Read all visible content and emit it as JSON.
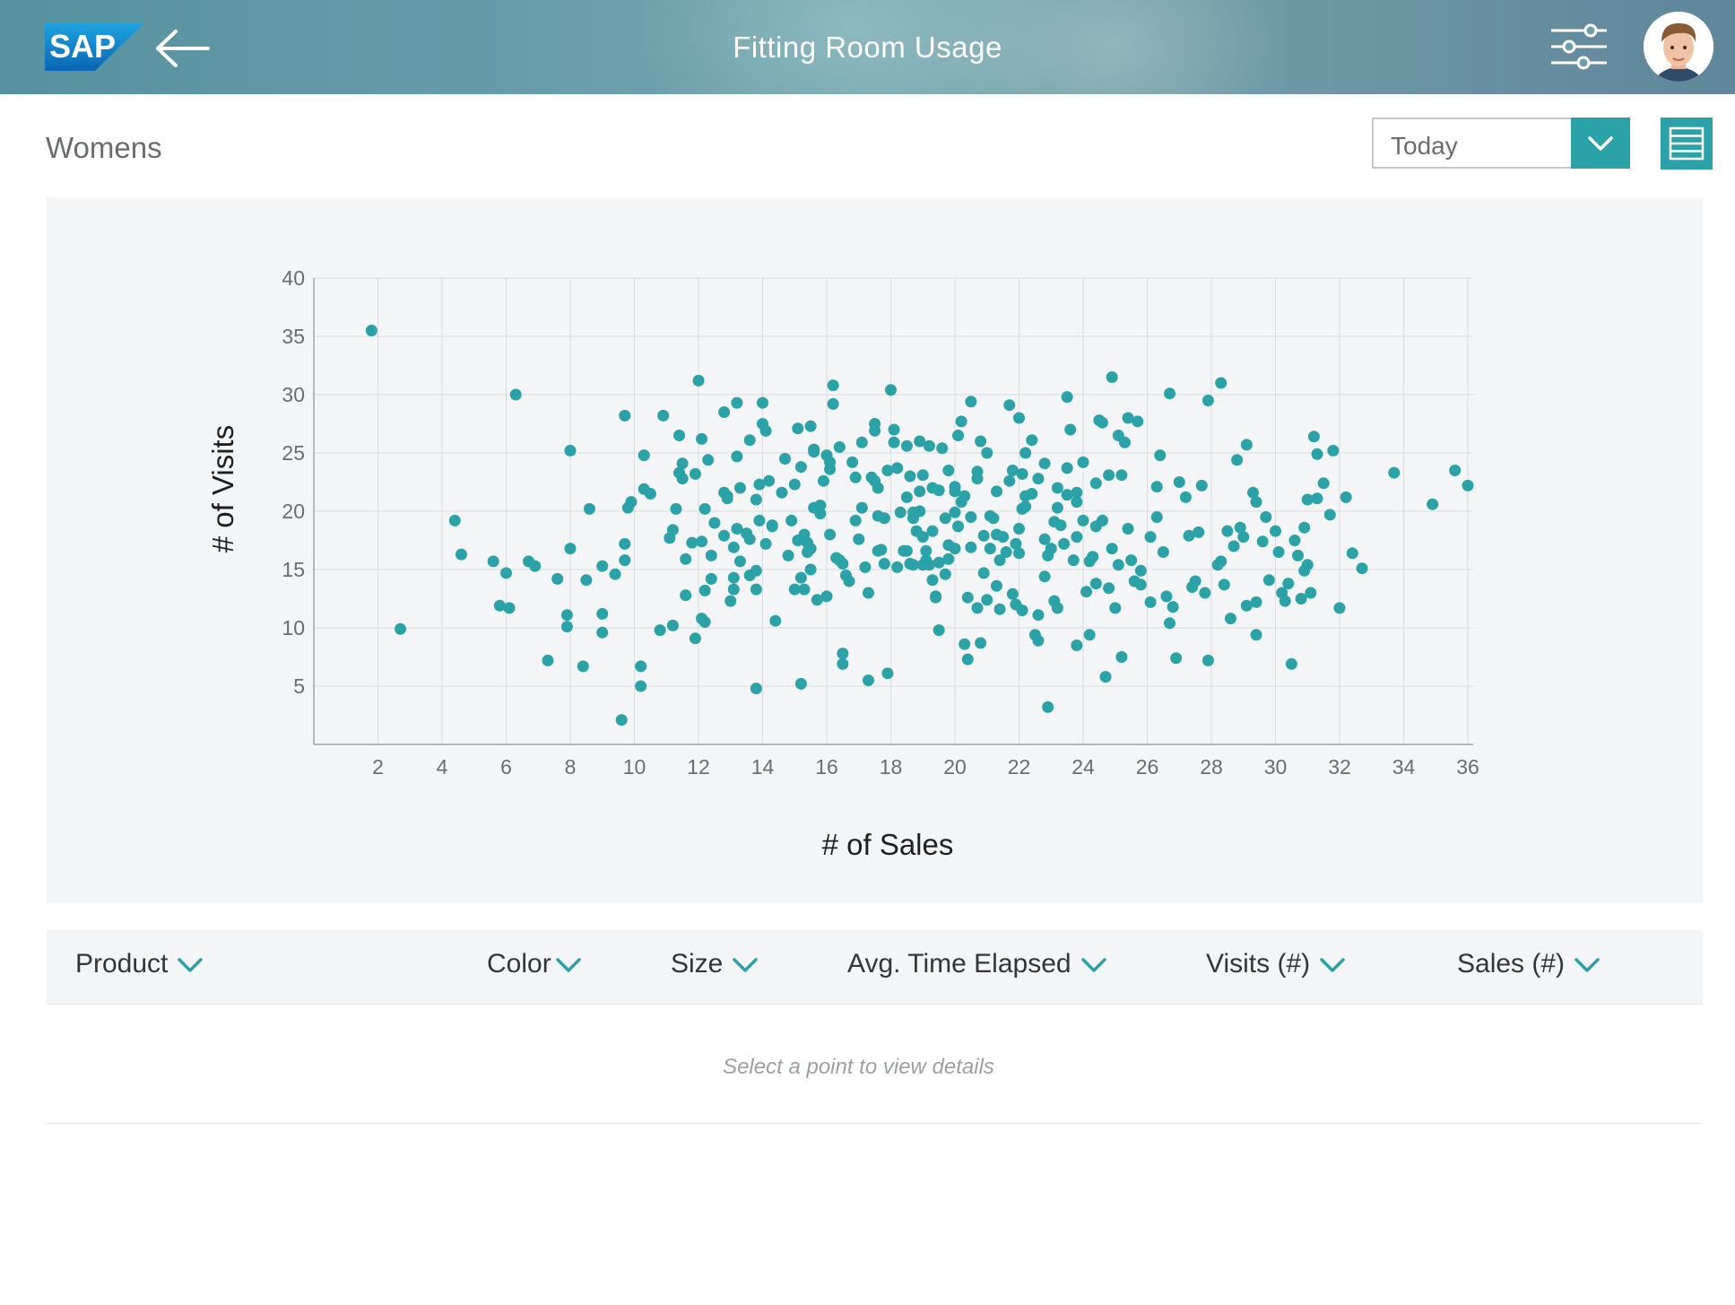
{
  "header": {
    "logo_text": "SAP",
    "title": "Fitting Room Usage",
    "back_icon": "arrow-left-icon",
    "settings_icon": "sliders-icon",
    "avatar_icon": "user-avatar"
  },
  "section": {
    "title": "Womens"
  },
  "filter": {
    "selected": "Today",
    "dropdown_icon": "chevron-down-icon",
    "view_icon": "list-view-icon"
  },
  "colors": {
    "accent": "#2aa2a7",
    "header_bg": "#6a9fab",
    "panel_bg": "#f4f5f6"
  },
  "table": {
    "columns": [
      "Product",
      "Color",
      "Size",
      "Avg. Time Elapsed",
      "Visits (#)",
      "Sales (#)"
    ],
    "empty_message": "Select a point to view details"
  },
  "chart_data": {
    "type": "scatter",
    "xlabel": "# of Sales",
    "ylabel": "# of Visits",
    "xlim": [
      0,
      36
    ],
    "ylim": [
      0,
      40
    ],
    "xticks": [
      2,
      4,
      6,
      8,
      10,
      12,
      14,
      16,
      18,
      20,
      22,
      24,
      26,
      28,
      30,
      32,
      34,
      36
    ],
    "yticks": [
      5,
      10,
      15,
      20,
      25,
      30,
      35,
      40
    ],
    "grid": true,
    "point_color": "#2aa2a7",
    "points": [
      [
        1.8,
        35.5
      ],
      [
        2.7,
        9.9
      ],
      [
        4.4,
        19.2
      ],
      [
        4.6,
        16.3
      ],
      [
        5.6,
        15.7
      ],
      [
        6.0,
        14.7
      ],
      [
        6.3,
        30.0
      ],
      [
        5.8,
        11.9
      ],
      [
        6.1,
        11.7
      ],
      [
        6.7,
        15.7
      ],
      [
        6.9,
        15.3
      ],
      [
        7.3,
        7.2
      ],
      [
        7.6,
        14.2
      ],
      [
        7.9,
        11.1
      ],
      [
        7.9,
        10.1
      ],
      [
        8.0,
        16.8
      ],
      [
        8.0,
        25.2
      ],
      [
        8.4,
        6.7
      ],
      [
        8.5,
        14.1
      ],
      [
        8.6,
        20.2
      ],
      [
        9.0,
        15.3
      ],
      [
        9.0,
        11.2
      ],
      [
        9.0,
        9.6
      ],
      [
        9.4,
        14.6
      ],
      [
        9.6,
        2.1
      ],
      [
        9.7,
        28.2
      ],
      [
        9.7,
        17.2
      ],
      [
        9.7,
        15.8
      ],
      [
        9.8,
        20.3
      ],
      [
        9.9,
        20.8
      ],
      [
        10.2,
        5.0
      ],
      [
        10.2,
        6.7
      ],
      [
        10.3,
        21.9
      ],
      [
        10.3,
        24.8
      ],
      [
        10.5,
        21.5
      ],
      [
        10.8,
        9.8
      ],
      [
        11.1,
        17.7
      ],
      [
        11.2,
        18.4
      ],
      [
        11.2,
        10.2
      ],
      [
        11.3,
        20.2
      ],
      [
        11.4,
        26.5
      ],
      [
        11.4,
        23.3
      ],
      [
        11.5,
        22.8
      ],
      [
        11.5,
        24.1
      ],
      [
        11.6,
        15.9
      ],
      [
        11.6,
        12.8
      ],
      [
        11.8,
        17.3
      ],
      [
        11.9,
        23.2
      ],
      [
        11.9,
        9.1
      ],
      [
        12.0,
        31.2
      ],
      [
        12.1,
        10.8
      ],
      [
        12.1,
        26.2
      ],
      [
        12.1,
        17.4
      ],
      [
        12.2,
        20.2
      ],
      [
        12.2,
        13.2
      ],
      [
        12.3,
        24.4
      ],
      [
        12.4,
        16.2
      ],
      [
        12.4,
        14.2
      ],
      [
        12.8,
        21.6
      ],
      [
        12.8,
        17.9
      ],
      [
        12.8,
        28.5
      ],
      [
        12.9,
        21.3
      ],
      [
        12.9,
        21.1
      ],
      [
        13.0,
        12.3
      ],
      [
        13.1,
        13.3
      ],
      [
        13.1,
        16.9
      ],
      [
        13.1,
        14.3
      ],
      [
        13.2,
        29.3
      ],
      [
        13.2,
        24.7
      ],
      [
        13.2,
        18.5
      ],
      [
        13.3,
        22.0
      ],
      [
        13.3,
        15.7
      ],
      [
        13.5,
        18.1
      ],
      [
        13.6,
        26.1
      ],
      [
        13.6,
        14.5
      ],
      [
        13.6,
        17.6
      ],
      [
        13.8,
        21.0
      ],
      [
        13.8,
        13.3
      ],
      [
        13.8,
        4.8
      ],
      [
        13.8,
        14.9
      ],
      [
        13.9,
        22.3
      ],
      [
        13.9,
        19.2
      ],
      [
        14.0,
        29.3
      ],
      [
        14.0,
        27.5
      ],
      [
        14.1,
        26.9
      ],
      [
        14.2,
        22.6
      ],
      [
        14.3,
        18.7
      ],
      [
        14.3,
        18.8
      ],
      [
        14.4,
        10.6
      ],
      [
        14.6,
        21.6
      ],
      [
        14.7,
        24.5
      ],
      [
        14.8,
        16.2
      ],
      [
        14.9,
        19.2
      ],
      [
        15.0,
        13.3
      ],
      [
        15.0,
        22.3
      ],
      [
        15.1,
        27.1
      ],
      [
        15.1,
        17.5
      ],
      [
        15.2,
        14.3
      ],
      [
        15.2,
        23.8
      ],
      [
        15.2,
        5.2
      ],
      [
        15.3,
        13.3
      ],
      [
        15.3,
        18.0
      ],
      [
        15.4,
        17.3
      ],
      [
        15.4,
        16.5
      ],
      [
        15.5,
        27.3
      ],
      [
        15.5,
        15.0
      ],
      [
        15.5,
        16.8
      ],
      [
        15.6,
        25.3
      ],
      [
        15.6,
        25.1
      ],
      [
        15.6,
        20.3
      ],
      [
        15.8,
        20.5
      ],
      [
        15.8,
        19.8
      ],
      [
        15.9,
        22.6
      ],
      [
        16.0,
        24.8
      ],
      [
        16.1,
        24.2
      ],
      [
        16.1,
        23.6
      ],
      [
        16.1,
        18.0
      ],
      [
        16.2,
        29.2
      ],
      [
        16.2,
        30.8
      ],
      [
        16.3,
        16.0
      ],
      [
        16.4,
        25.5
      ],
      [
        16.5,
        6.9
      ],
      [
        16.5,
        7.8
      ],
      [
        16.5,
        15.5
      ],
      [
        16.6,
        14.5
      ],
      [
        16.7,
        14.0
      ],
      [
        16.8,
        24.2
      ],
      [
        16.9,
        19.2
      ],
      [
        16.9,
        22.9
      ],
      [
        17.0,
        17.6
      ],
      [
        17.1,
        20.3
      ],
      [
        17.1,
        25.9
      ],
      [
        17.2,
        15.2
      ],
      [
        17.3,
        13.0
      ],
      [
        17.3,
        5.5
      ],
      [
        17.4,
        22.9
      ],
      [
        17.5,
        26.9
      ],
      [
        17.5,
        27.5
      ],
      [
        17.6,
        22.0
      ],
      [
        17.6,
        19.6
      ],
      [
        17.7,
        16.7
      ],
      [
        17.8,
        19.4
      ],
      [
        17.8,
        15.5
      ],
      [
        17.9,
        6.1
      ],
      [
        17.9,
        23.5
      ],
      [
        18.0,
        30.4
      ],
      [
        18.1,
        27.0
      ],
      [
        18.1,
        25.9
      ],
      [
        18.2,
        23.7
      ],
      [
        18.2,
        15.2
      ],
      [
        18.3,
        19.9
      ],
      [
        18.5,
        25.6
      ],
      [
        18.5,
        16.6
      ],
      [
        18.5,
        21.2
      ],
      [
        18.6,
        23.0
      ],
      [
        18.6,
        15.5
      ],
      [
        18.7,
        19.4
      ],
      [
        18.7,
        19.9
      ],
      [
        18.7,
        15.4
      ],
      [
        18.8,
        18.3
      ],
      [
        18.9,
        20.0
      ],
      [
        18.9,
        26.0
      ],
      [
        19.0,
        23.1
      ],
      [
        19.0,
        17.8
      ],
      [
        19.0,
        15.4
      ],
      [
        19.1,
        15.8
      ],
      [
        19.1,
        16.6
      ],
      [
        19.2,
        25.6
      ],
      [
        19.2,
        15.4
      ],
      [
        19.3,
        18.3
      ],
      [
        19.3,
        22.0
      ],
      [
        19.3,
        14.1
      ],
      [
        19.4,
        12.7
      ],
      [
        19.4,
        12.6
      ],
      [
        19.5,
        21.8
      ],
      [
        19.5,
        9.8
      ],
      [
        19.6,
        25.4
      ],
      [
        19.7,
        19.4
      ],
      [
        19.7,
        14.6
      ],
      [
        19.8,
        15.9
      ],
      [
        19.8,
        17.1
      ],
      [
        20.0,
        21.7
      ],
      [
        20.0,
        16.8
      ],
      [
        20.0,
        19.9
      ],
      [
        20.0,
        22.1
      ],
      [
        20.1,
        18.7
      ],
      [
        20.1,
        26.5
      ],
      [
        20.2,
        20.8
      ],
      [
        20.2,
        27.7
      ],
      [
        20.3,
        21.3
      ],
      [
        20.3,
        8.6
      ],
      [
        20.4,
        7.3
      ],
      [
        20.4,
        12.6
      ],
      [
        20.5,
        29.4
      ],
      [
        20.5,
        19.5
      ],
      [
        20.5,
        16.9
      ],
      [
        20.7,
        22.8
      ],
      [
        20.7,
        11.7
      ],
      [
        20.8,
        8.7
      ],
      [
        20.8,
        26.0
      ],
      [
        20.9,
        17.9
      ],
      [
        20.9,
        14.7
      ],
      [
        21.0,
        25.0
      ],
      [
        21.0,
        12.4
      ],
      [
        21.1,
        19.6
      ],
      [
        21.1,
        16.8
      ],
      [
        21.2,
        19.4
      ],
      [
        21.3,
        18.0
      ],
      [
        21.3,
        21.7
      ],
      [
        21.3,
        13.6
      ],
      [
        21.4,
        15.8
      ],
      [
        21.5,
        17.8
      ],
      [
        21.6,
        16.5
      ],
      [
        21.7,
        22.6
      ],
      [
        21.7,
        29.1
      ],
      [
        21.8,
        12.9
      ],
      [
        21.9,
        17.2
      ],
      [
        21.9,
        12.0
      ],
      [
        22.0,
        28.0
      ],
      [
        22.0,
        18.5
      ],
      [
        22.0,
        16.4
      ],
      [
        22.1,
        23.2
      ],
      [
        22.1,
        20.2
      ],
      [
        22.2,
        20.4
      ],
      [
        22.2,
        21.3
      ],
      [
        22.2,
        25.0
      ],
      [
        22.4,
        21.5
      ],
      [
        22.4,
        26.1
      ],
      [
        22.5,
        9.4
      ],
      [
        22.6,
        22.8
      ],
      [
        22.6,
        11.1
      ],
      [
        22.6,
        8.9
      ],
      [
        22.8,
        24.1
      ],
      [
        22.8,
        17.6
      ],
      [
        22.8,
        14.4
      ],
      [
        22.9,
        16.2
      ],
      [
        22.9,
        3.2
      ],
      [
        23.0,
        16.8
      ],
      [
        23.1,
        19.1
      ],
      [
        23.1,
        12.3
      ],
      [
        23.2,
        20.3
      ],
      [
        23.2,
        22.0
      ],
      [
        23.3,
        18.8
      ],
      [
        23.4,
        17.2
      ],
      [
        23.5,
        29.8
      ],
      [
        23.5,
        23.7
      ],
      [
        23.5,
        21.4
      ],
      [
        23.6,
        27.0
      ],
      [
        23.7,
        15.8
      ],
      [
        23.8,
        17.8
      ],
      [
        23.8,
        8.5
      ],
      [
        23.8,
        20.8
      ],
      [
        24.0,
        19.2
      ],
      [
        24.0,
        24.2
      ],
      [
        24.1,
        13.1
      ],
      [
        24.2,
        9.4
      ],
      [
        24.2,
        15.7
      ],
      [
        24.3,
        16.1
      ],
      [
        24.4,
        22.4
      ],
      [
        24.4,
        18.7
      ],
      [
        24.5,
        27.8
      ],
      [
        24.6,
        27.6
      ],
      [
        24.6,
        19.2
      ],
      [
        24.7,
        5.8
      ],
      [
        24.8,
        23.1
      ],
      [
        24.8,
        13.4
      ],
      [
        24.9,
        31.5
      ],
      [
        24.9,
        16.8
      ],
      [
        25.0,
        11.7
      ],
      [
        25.1,
        26.5
      ],
      [
        25.1,
        15.4
      ],
      [
        25.2,
        7.5
      ],
      [
        25.2,
        23.1
      ],
      [
        25.3,
        25.9
      ],
      [
        25.4,
        28.0
      ],
      [
        25.5,
        15.8
      ],
      [
        25.6,
        14.0
      ],
      [
        25.7,
        27.7
      ],
      [
        25.8,
        14.9
      ],
      [
        25.8,
        13.7
      ],
      [
        26.1,
        12.2
      ],
      [
        26.3,
        22.1
      ],
      [
        26.3,
        19.5
      ],
      [
        26.4,
        24.8
      ],
      [
        26.5,
        16.5
      ],
      [
        26.6,
        12.7
      ],
      [
        26.7,
        10.4
      ],
      [
        26.7,
        30.1
      ],
      [
        26.8,
        11.8
      ],
      [
        26.9,
        7.4
      ],
      [
        27.0,
        22.5
      ],
      [
        27.2,
        21.2
      ],
      [
        27.3,
        17.9
      ],
      [
        27.5,
        14.0
      ],
      [
        27.6,
        18.2
      ],
      [
        27.7,
        22.2
      ],
      [
        27.8,
        13.0
      ],
      [
        27.9,
        29.5
      ],
      [
        27.9,
        7.2
      ],
      [
        28.2,
        15.4
      ],
      [
        28.3,
        31.0
      ],
      [
        28.4,
        13.7
      ],
      [
        28.5,
        18.3
      ],
      [
        28.6,
        10.8
      ],
      [
        28.7,
        17.0
      ],
      [
        28.8,
        24.4
      ],
      [
        28.9,
        18.6
      ],
      [
        29.0,
        17.8
      ],
      [
        29.1,
        11.9
      ],
      [
        29.1,
        25.7
      ],
      [
        29.3,
        21.6
      ],
      [
        29.4,
        20.8
      ],
      [
        29.4,
        9.4
      ],
      [
        29.6,
        17.4
      ],
      [
        29.7,
        19.5
      ],
      [
        29.8,
        14.1
      ],
      [
        30.0,
        18.3
      ],
      [
        30.1,
        16.5
      ],
      [
        30.2,
        13.0
      ],
      [
        30.4,
        13.8
      ],
      [
        30.5,
        6.9
      ],
      [
        30.6,
        17.5
      ],
      [
        30.7,
        16.2
      ],
      [
        30.8,
        12.5
      ],
      [
        30.9,
        14.9
      ],
      [
        30.9,
        18.6
      ],
      [
        31.0,
        21.0
      ],
      [
        31.0,
        15.4
      ],
      [
        31.1,
        13.0
      ],
      [
        31.2,
        26.4
      ],
      [
        31.3,
        21.1
      ],
      [
        31.3,
        24.9
      ],
      [
        31.5,
        22.4
      ],
      [
        31.7,
        19.7
      ],
      [
        31.8,
        25.2
      ],
      [
        32.0,
        11.7
      ],
      [
        32.2,
        21.2
      ],
      [
        32.4,
        16.4
      ],
      [
        32.7,
        15.1
      ],
      [
        33.7,
        23.3
      ],
      [
        34.9,
        20.6
      ],
      [
        35.6,
        23.5
      ],
      [
        36.0,
        22.2
      ],
      [
        10.9,
        28.2
      ],
      [
        12.2,
        10.5
      ],
      [
        15.7,
        12.4
      ],
      [
        16.0,
        12.7
      ],
      [
        16.4,
        15.8
      ],
      [
        17.6,
        16.6
      ],
      [
        17.5,
        22.6
      ],
      [
        18.4,
        16.6
      ],
      [
        18.9,
        21.7
      ],
      [
        19.5,
        15.6
      ],
      [
        21.4,
        11.6
      ],
      [
        22.1,
        11.5
      ],
      [
        23.2,
        11.7
      ],
      [
        24.4,
        13.8
      ],
      [
        25.4,
        18.5
      ],
      [
        26.1,
        17.8
      ],
      [
        27.4,
        13.5
      ],
      [
        28.3,
        15.7
      ],
      [
        29.4,
        12.2
      ],
      [
        30.3,
        12.3
      ],
      [
        23.8,
        21.6
      ],
      [
        21.8,
        23.5
      ],
      [
        20.7,
        23.4
      ],
      [
        19.8,
        23.5
      ],
      [
        14.1,
        17.2
      ],
      [
        12.5,
        19.0
      ]
    ]
  }
}
